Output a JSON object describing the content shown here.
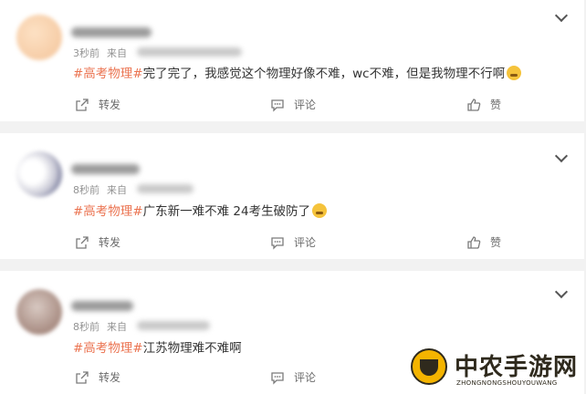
{
  "posts": [
    {
      "time": "3秒前",
      "from_label": "来自",
      "topic": "#高考物理#",
      "text": "完了完了，我感觉这个物理好像不难，wc不难，但是我物理不行啊",
      "emoji": "crying-face",
      "repost_label": "转发",
      "comment_label": "评论",
      "like_label": "赞"
    },
    {
      "time": "8秒前",
      "from_label": "来自",
      "topic": "#高考物理#",
      "text": "广东新一难不难 24考生破防了",
      "emoji": "scared-face",
      "repost_label": "转发",
      "comment_label": "评论",
      "like_label": "赞"
    },
    {
      "time": "8秒前",
      "from_label": "来自",
      "topic": "#高考物理#",
      "text": "江苏物理难不难啊",
      "emoji": "",
      "repost_label": "转发",
      "comment_label": "评论",
      "like_label": "赞"
    }
  ],
  "watermark": {
    "title": "中农手游网",
    "subtitle": "ZHONGNONGSHOUYOUWANG"
  },
  "colors": {
    "topic": "#eb7350",
    "text": "#333333",
    "meta": "#939393",
    "background": "#f2f2f2"
  }
}
